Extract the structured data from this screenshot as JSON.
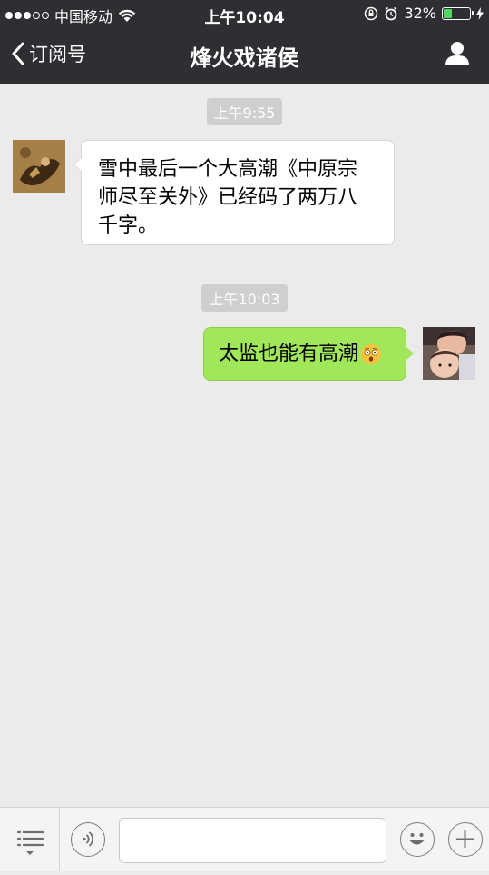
{
  "status_bar": {
    "carrier": "中国移动",
    "time": "上午10:04",
    "battery_percent": "32%",
    "battery_level": 0.32,
    "battery_color": "#4cd964"
  },
  "nav": {
    "back_label": "订阅号",
    "title": "烽火戏诸侯",
    "profile_icon": "person-icon"
  },
  "messages": [
    {
      "type": "timestamp",
      "text": "上午9:55"
    },
    {
      "type": "received",
      "lines": [
        "雪中最后一个大高潮《中原宗",
        "师尽至关外》已经码了两万八",
        "千字。"
      ]
    },
    {
      "type": "timestamp",
      "text": "上午10:03"
    },
    {
      "type": "sent",
      "text": "太监也能有高潮",
      "emoji": "astonished-face-emoji"
    }
  ],
  "input_bar": {
    "menu_icon": "menu-list-icon",
    "voice_icon": "voice-icon",
    "input_placeholder": "",
    "emoji_icon": "smiley-icon",
    "plus_icon": "plus-icon"
  },
  "colors": {
    "header_bg": "#2f2f33",
    "chat_bg": "#ebebeb",
    "sent_bubble": "#a0e75a",
    "received_bubble": "#ffffff"
  }
}
